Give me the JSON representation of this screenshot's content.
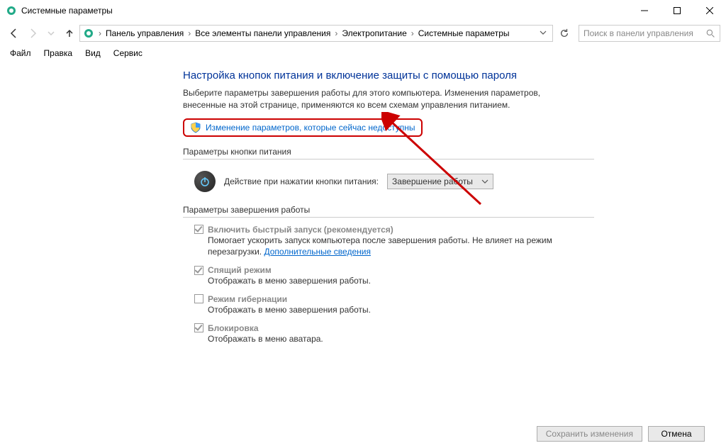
{
  "window": {
    "title": "Системные параметры"
  },
  "breadcrumb": {
    "parts": [
      "Панель управления",
      "Все элементы панели управления",
      "Электропитание",
      "Системные параметры"
    ]
  },
  "search": {
    "placeholder": "Поиск в панели управления"
  },
  "menu": [
    "Файл",
    "Правка",
    "Вид",
    "Сервис"
  ],
  "content": {
    "heading": "Настройка кнопок питания и включение защиты с помощью пароля",
    "subtext": "Выберите параметры завершения работы для этого компьютера. Изменения параметров, внесенные на этой странице, применяются ко всем схемам управления питанием.",
    "change_link": "Изменение параметров, которые сейчас недоступны",
    "section_power_button": "Параметры кнопки питания",
    "power_action_label": "Действие при нажатии кнопки питания:",
    "power_action_value": "Завершение работы",
    "section_shutdown": "Параметры завершения работы",
    "options": [
      {
        "label": "Включить быстрый запуск (рекомендуется)",
        "checked": true,
        "desc_pre": "Помогает ускорить запуск компьютера после завершения работы. Не влияет на режим перезагрузки. ",
        "link": "Дополнительные сведения",
        "desc_post": ""
      },
      {
        "label": "Спящий режим",
        "checked": true,
        "desc_pre": "Отображать в меню завершения работы.",
        "link": "",
        "desc_post": ""
      },
      {
        "label": "Режим гибернации",
        "checked": false,
        "desc_pre": "Отображать в меню завершения работы.",
        "link": "",
        "desc_post": ""
      },
      {
        "label": "Блокировка",
        "checked": true,
        "desc_pre": "Отображать в меню аватара.",
        "link": "",
        "desc_post": ""
      }
    ]
  },
  "footer": {
    "save": "Сохранить изменения",
    "cancel": "Отмена"
  }
}
